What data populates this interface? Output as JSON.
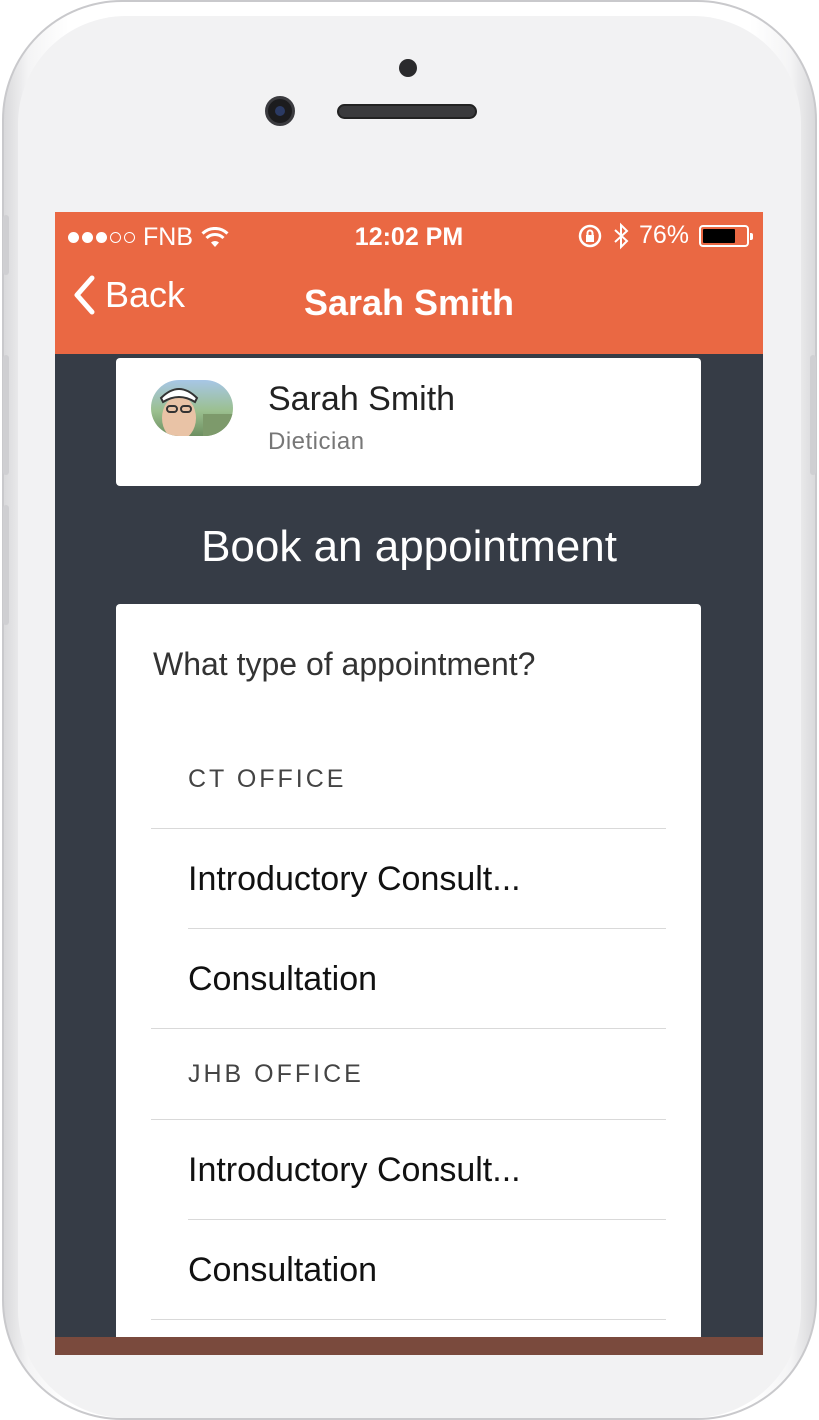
{
  "status_bar": {
    "carrier": "FNB",
    "time": "12:02 PM",
    "battery_percent": "76%",
    "battery_level": 0.76,
    "icons": [
      "signal-dots-icon",
      "wifi-icon",
      "rotation-lock-icon",
      "bluetooth-icon",
      "battery-icon"
    ]
  },
  "nav": {
    "back_label": "Back",
    "title": "Sarah Smith",
    "color": "#ea6843"
  },
  "profile": {
    "name": "Sarah Smith",
    "role": "Dietician"
  },
  "booking": {
    "heading": "Book an appointment",
    "question": "What type of appointment?",
    "groups": [
      {
        "header": "CT OFFICE",
        "options": [
          "Introductory Consult...",
          "Consultation"
        ]
      },
      {
        "header": "JHB OFFICE",
        "options": [
          "Introductory Consult...",
          "Consultation"
        ]
      }
    ]
  },
  "colors": {
    "background": "#363c46",
    "accent": "#ea6843",
    "card": "#ffffff"
  }
}
